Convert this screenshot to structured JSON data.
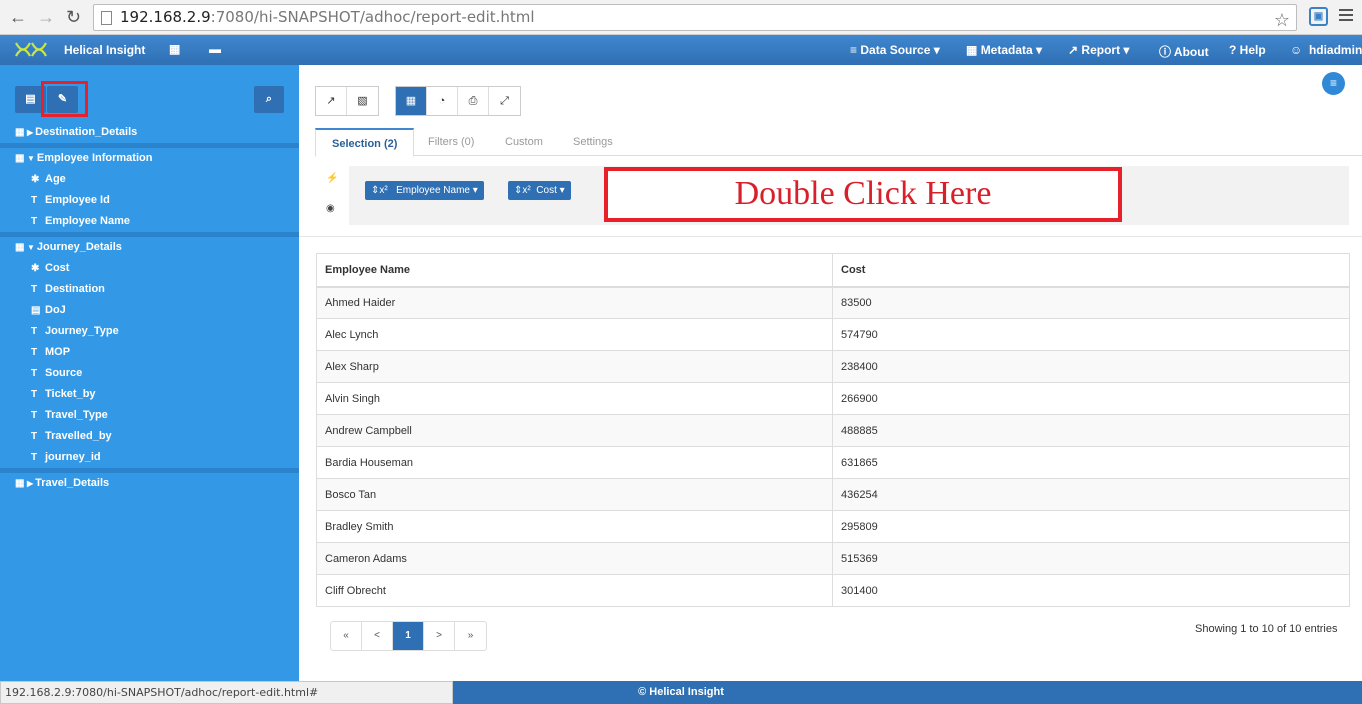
{
  "browser": {
    "url_host": "192.168.2.9",
    "url_rest": ":7080/hi-SNAPSHOT/adhoc/report-edit.html",
    "back_icon": "arrow-left",
    "forward_icon": "arrow-right",
    "reload_icon": "reload",
    "status_url": "192.168.2.9:7080/hi-SNAPSHOT/adhoc/report-edit.html#"
  },
  "topnav": {
    "brand": "Helical Insight",
    "data_source": "Data Source ▾",
    "metadata": "Metadata ▾",
    "report": "Report ▾",
    "about": "About",
    "help": "? Help",
    "user": "hdiadmin"
  },
  "sidebar": {
    "tree": [
      {
        "label": "Destination_Details",
        "level": 0,
        "icon": "table",
        "expanded": false
      },
      {
        "label": "Employee Information",
        "level": 0,
        "icon": "table",
        "expanded": true
      },
      {
        "label": "Age",
        "level": 1,
        "icon": "numeric"
      },
      {
        "label": "Employee Id",
        "level": 1,
        "icon": "text"
      },
      {
        "label": "Employee Name",
        "level": 1,
        "icon": "text"
      },
      {
        "label": "Journey_Details",
        "level": 0,
        "icon": "table",
        "expanded": true
      },
      {
        "label": "Cost",
        "level": 1,
        "icon": "numeric"
      },
      {
        "label": "Destination",
        "level": 1,
        "icon": "text"
      },
      {
        "label": "DoJ",
        "level": 1,
        "icon": "calendar"
      },
      {
        "label": "Journey_Type",
        "level": 1,
        "icon": "text"
      },
      {
        "label": "MOP",
        "level": 1,
        "icon": "text"
      },
      {
        "label": "Source",
        "level": 1,
        "icon": "text"
      },
      {
        "label": "Ticket_by",
        "level": 1,
        "icon": "text"
      },
      {
        "label": "Travel_Type",
        "level": 1,
        "icon": "text"
      },
      {
        "label": "Travelled_by",
        "level": 1,
        "icon": "text"
      },
      {
        "label": "journey_id",
        "level": 1,
        "icon": "text"
      },
      {
        "label": "Travel_Details",
        "level": 0,
        "icon": "table",
        "expanded": false
      }
    ]
  },
  "tabs": [
    {
      "label": "Selection (2)",
      "active": true
    },
    {
      "label": "Filters (0)",
      "active": false
    },
    {
      "label": "Custom",
      "active": false
    },
    {
      "label": "Settings",
      "active": false
    }
  ],
  "selection": {
    "pills": [
      "Employee Name",
      "Cost"
    ],
    "pill_prefix": "⇕x²",
    "annotation": "Double Click Here"
  },
  "table": {
    "headers": [
      "Employee Name",
      "Cost"
    ],
    "rows": [
      [
        "Ahmed Haider",
        "83500"
      ],
      [
        "Alec Lynch",
        "574790"
      ],
      [
        "Alex Sharp",
        "238400"
      ],
      [
        "Alvin Singh",
        "266900"
      ],
      [
        "Andrew Campbell",
        "488885"
      ],
      [
        "Bardia Houseman",
        "631865"
      ],
      [
        "Bosco Tan",
        "436254"
      ],
      [
        "Bradley Smith",
        "295809"
      ],
      [
        "Cameron Adams",
        "515369"
      ],
      [
        "Cliff Obrecht",
        "301400"
      ]
    ]
  },
  "pagination": {
    "first": "«",
    "prev": "<",
    "current": "1",
    "next": ">",
    "last": "»",
    "showing": "Showing 1 to 10 of 10 entries"
  },
  "footer": {
    "text": "© Helical Insight"
  },
  "colors": {
    "accent": "#2f6fb3",
    "sidebar": "#3399e6",
    "highlight": "#e8202a"
  }
}
